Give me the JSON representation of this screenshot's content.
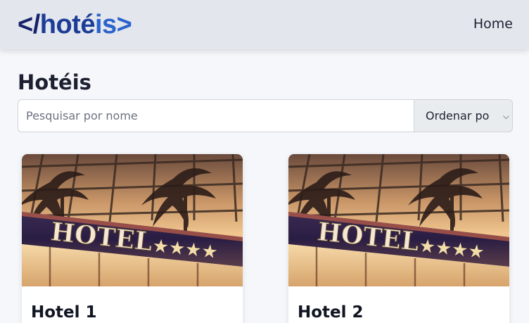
{
  "header": {
    "logo": {
      "part1": "</",
      "part2": "hoté",
      "part3": "is>"
    },
    "nav": {
      "home": "Home"
    }
  },
  "main": {
    "title": "Hotéis",
    "search": {
      "placeholder": "Pesquisar por nome",
      "value": ""
    },
    "sort": {
      "selected": "Ordenar po"
    },
    "hotels": [
      {
        "name": "Hotel 1",
        "sign_text": "HOTEL"
      },
      {
        "name": "Hotel 2",
        "sign_text": "HOTEL"
      }
    ]
  },
  "icons": {
    "sort_caret": "chevron-down-icon"
  }
}
